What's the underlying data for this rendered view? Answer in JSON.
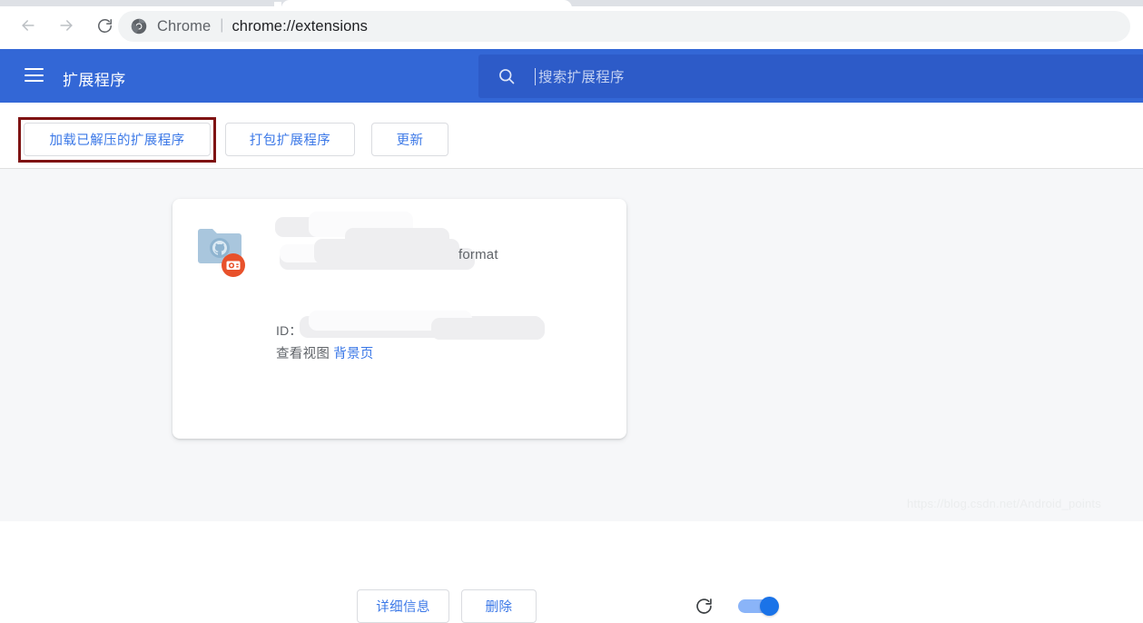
{
  "browser": {
    "back_icon": "arrow-left-icon",
    "forward_icon": "arrow-right-icon",
    "reload_icon": "reload-icon",
    "omnibox": {
      "logo_icon": "chrome-logo-icon",
      "scheme_label": "Chrome",
      "separator": "|",
      "url": "chrome://extensions"
    }
  },
  "ext_header": {
    "menu_icon": "hamburger-menu-icon",
    "title": "扩展程序",
    "search": {
      "icon": "search-icon",
      "placeholder": "搜索扩展程序",
      "value": ""
    },
    "background_color": "#3367d6",
    "search_background_color": "#2d5bc8"
  },
  "actions": {
    "load_unpacked_label": "加载已解压的扩展程序",
    "pack_extension_label": "打包扩展程序",
    "update_label": "更新",
    "highlight_color": "#7f1313"
  },
  "extension_card": {
    "icon_name": "folder-extension-icon",
    "badge_icon": "unpacked-extension-badge-icon",
    "name": "",
    "name_redacted": true,
    "description_tail": "format",
    "description_redacted": true,
    "id_label": "ID：",
    "id_value": "",
    "id_redacted": true,
    "views_label": "查看视图",
    "views_link_label": "背景页",
    "details_button_label": "详细信息",
    "remove_button_label": "删除",
    "reload_icon": "reload-icon",
    "toggle_icon": "enabled-toggle",
    "toggle_on": true,
    "toggle_color": "#1a73e8"
  },
  "watermark": {
    "text": "https://blog.csdn.net/Android_points"
  }
}
